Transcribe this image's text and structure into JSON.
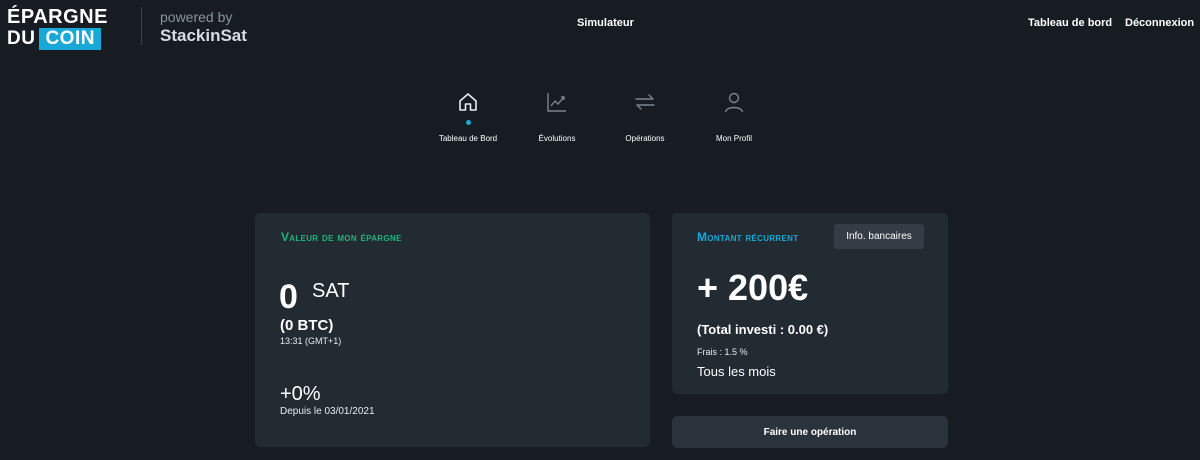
{
  "header": {
    "logo": {
      "line1": "ÉPARGNE",
      "du": "DU",
      "coin": "COIN"
    },
    "powered_by": "powered by",
    "partner": "StackinSat",
    "nav_center": "Simulateur",
    "nav_dashboard": "Tableau de bord",
    "nav_logout": "Déconnexion"
  },
  "tabs": [
    {
      "label": "Tableau de Bord",
      "icon": "home-icon",
      "active": true
    },
    {
      "label": "Évolutions",
      "icon": "chart-line-icon",
      "active": false
    },
    {
      "label": "Opérations",
      "icon": "transfer-arrows-icon",
      "active": false
    },
    {
      "label": "Mon Profil",
      "icon": "user-icon",
      "active": false
    }
  ],
  "savings_card": {
    "title": "Valeur de mon épargne",
    "amount": "0",
    "unit": "SAT",
    "btc": "(0 BTC)",
    "time": "13:31 (GMT+1)",
    "performance": "+0%",
    "since": "Depuis le 03/01/2021"
  },
  "recurring_card": {
    "title": "Montant récurrent",
    "bank_info_button": "Info. bancaires",
    "amount": "+ 200€",
    "total_invested": "(Total investi : 0.00 €)",
    "fees": "Frais : 1.5 %",
    "frequency": "Tous les mois"
  },
  "operation_button": "Faire une opération",
  "colors": {
    "background": "#161c22",
    "card": "#222a32",
    "accent_blue": "#19a9d8",
    "accent_green": "#22b37a"
  }
}
